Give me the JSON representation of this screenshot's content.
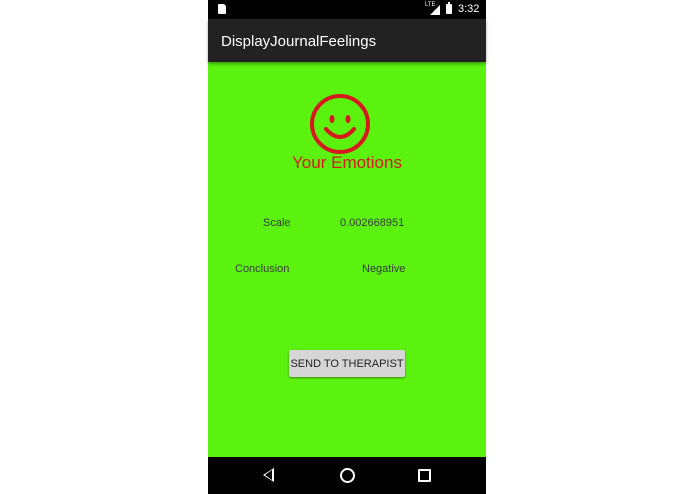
{
  "statusbar": {
    "network": "LTE",
    "time": "3:32"
  },
  "appbar": {
    "title": "DisplayJournalFeelings"
  },
  "main": {
    "emotions_label": "Your Emotions",
    "scale_label": "Scale",
    "scale_value": "0.002668951",
    "conclusion_label": "Conclusion",
    "conclusion_value": "Negative",
    "send_button": "SEND TO THERAPIST"
  },
  "colors": {
    "background": "#5cf20f",
    "smiley": "#d7191c",
    "appbar": "#222222"
  },
  "icons": [
    "sd-card-icon",
    "signal-icon",
    "battery-icon",
    "smiley-face-icon",
    "back-icon",
    "home-icon",
    "recents-icon"
  ]
}
